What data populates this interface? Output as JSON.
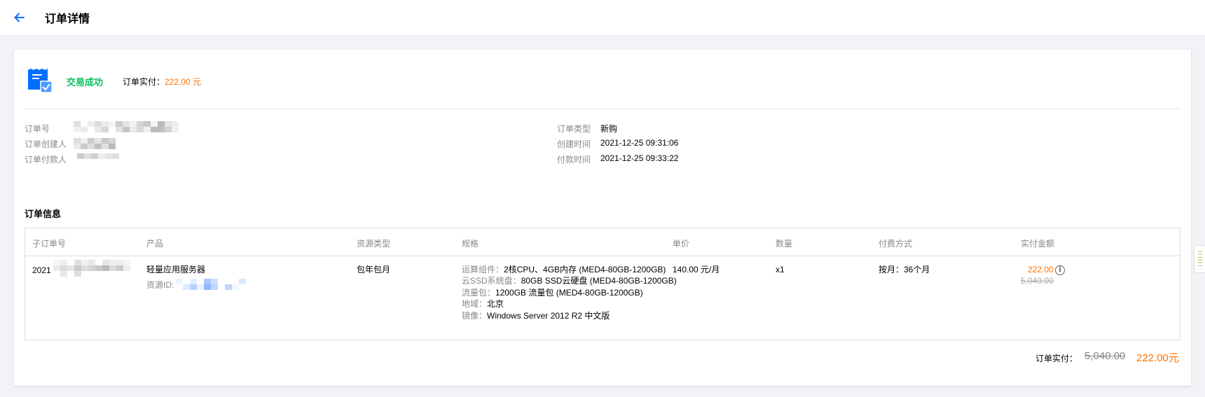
{
  "header": {
    "title": "订单详情"
  },
  "status": {
    "text": "交易成功",
    "paid_label": "订单实付：",
    "paid_amount": "222.00 元"
  },
  "info": {
    "order_no_label": "订单号",
    "creator_label": "订单创建人",
    "payer_label": "订单付款人",
    "order_type_label": "订单类型",
    "order_type": "新购",
    "created_label": "创建时间",
    "created_time": "2021-12-25 09:31:06",
    "paid_time_label": "付款时间",
    "paid_time": "2021-12-25 09:33:22"
  },
  "section_title": "订单信息",
  "table": {
    "headers": {
      "sub_order": "子订单号",
      "product": "产品",
      "resource_type": "资源类型",
      "spec": "规格",
      "unit_price": "单价",
      "quantity": "数量",
      "payment": "付费方式",
      "amount": "实付金额"
    },
    "row": {
      "sub_order_prefix": "2021",
      "product_name": "轻量应用服务器",
      "resource_id_label": "资源ID:",
      "resource_type": "包年包月",
      "spec": [
        {
          "label": "运算组件：",
          "value": "2核CPU、4GB内存 (MED4-80GB-1200GB)"
        },
        {
          "label": "云SSD系统盘：",
          "value": "80GB SSD云硬盘 (MED4-80GB-1200GB)"
        },
        {
          "label": "流量包：",
          "value": "1200GB 流量包 (MED4-80GB-1200GB)"
        },
        {
          "label": "地域：",
          "value": "北京"
        },
        {
          "label": "镜像：",
          "value": "Windows Server 2012 R2 中文版"
        }
      ],
      "unit_price": "140.00 元/月",
      "quantity": "x1",
      "payment": "按月：36个月",
      "amount": "222.00",
      "original_amount": "5,040.00"
    }
  },
  "total": {
    "label": "订单实付：",
    "original": "5,040.00",
    "final": "222.00元"
  },
  "colors": {
    "success": "#0abf5b",
    "accent_orange": "#ff7200",
    "primary_blue": "#006eff"
  }
}
